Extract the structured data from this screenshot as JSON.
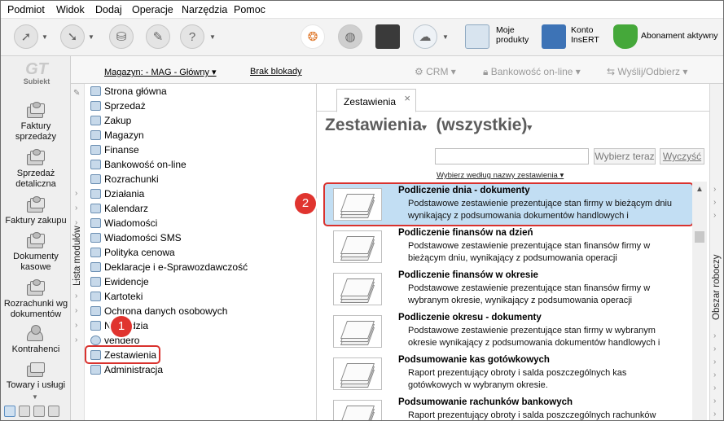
{
  "menu": [
    "Podmiot",
    "Widok",
    "Dodaj",
    "Operacje",
    "Narzędzia",
    "Pomoc"
  ],
  "toolbar": {
    "moje_produkty": [
      "Moje",
      "produkty"
    ],
    "konto": [
      "Konto",
      "InsERT"
    ],
    "abonament": "Abonament aktywny"
  },
  "subbar": {
    "magazyn": "Magazyn: - MAG - Główny",
    "blokady": "Brak blokady",
    "crm": "CRM",
    "bankowosc": "Bankowość on-line",
    "wyslij": "Wyślij/Odbierz"
  },
  "leftnav": {
    "logo_text": "Subiekt",
    "items": [
      "Faktury sprzedaży",
      "Sprzedaż detaliczna",
      "Faktury zakupu",
      "Dokumenty kasowe",
      "Rozrachunki wg dokumentów",
      "Kontrahenci",
      "Towary i usługi"
    ]
  },
  "modules": {
    "strip_label": "Lista modułów",
    "items": [
      "Strona główna",
      "Sprzedaż",
      "Zakup",
      "Magazyn",
      "Finanse",
      "Bankowość on-line",
      "Rozrachunki",
      "Działania",
      "Kalendarz",
      "Wiadomości",
      "Wiadomości SMS",
      "Polityka cenowa",
      "Deklaracje i e-Sprawozdawczość",
      "Ewidencje",
      "Kartoteki",
      "Ochrona danych osobowych",
      "Narzędzia",
      "vendero",
      "Zestawienia",
      "Administracja"
    ]
  },
  "badges": {
    "one": "1",
    "two": "2"
  },
  "main": {
    "tab_label": "Zestawienia",
    "tab_close": "×",
    "heading_title": "Zestawienia",
    "heading_filter": "(wszystkie)",
    "search_value": "",
    "search_button": "Wybierz teraz",
    "clear_button": "Wyczyść",
    "sort_link": "Wybierz według nazwy zestawienia",
    "reports": [
      {
        "title": "Podliczenie dnia - dokumenty",
        "desc": "Podstawowe zestawienie prezentujące stan firmy w bieżącym dniu wynikający z podsumowania dokumentów handlowych i"
      },
      {
        "title": "Podliczenie finansów na dzień",
        "desc": "Podstawowe zestawienie prezentujące stan finansów firmy w bieżącym dniu, wynikający z podsumowania operacji"
      },
      {
        "title": "Podliczenie finansów w okresie",
        "desc": "Podstawowe zestawienie prezentujące stan finansów firmy w wybranym okresie, wynikający z podsumowania operacji"
      },
      {
        "title": "Podliczenie okresu - dokumenty",
        "desc": "Podstawowe zestawienie prezentujące stan firmy w wybranym okresie wynikający z podsumowania dokumentów handlowych i"
      },
      {
        "title": "Podsumowanie kas gotówkowych",
        "desc": "Raport prezentujący obroty i salda poszczególnych kas gotówkowych w wybranym okresie."
      },
      {
        "title": "Podsumowanie rachunków bankowych",
        "desc": "Raport prezentujący obroty i salda poszczególnych rachunków"
      }
    ]
  },
  "right_panel": {
    "label": "Obszar roboczy"
  }
}
